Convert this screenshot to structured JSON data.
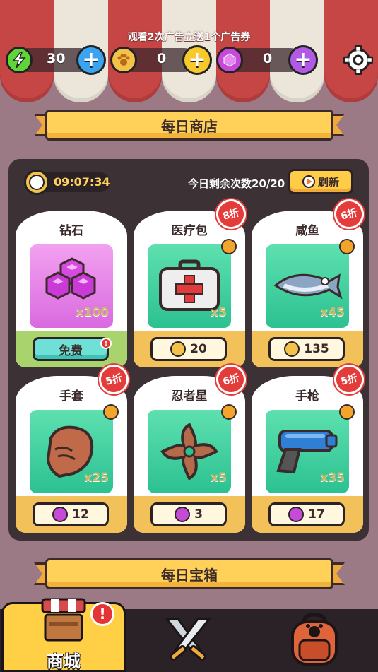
{
  "header": {
    "ad_text": "观看2次广告立送1个广告券",
    "resources": [
      {
        "icon": "energy-bolt-icon",
        "value": "30",
        "color": "#5ed63a"
      },
      {
        "icon": "paw-coin-icon",
        "value": "0",
        "color": "#f4c24a"
      },
      {
        "icon": "gem-icon",
        "value": "0",
        "color": "#c64ad8"
      }
    ]
  },
  "shop": {
    "title": "每日商店",
    "timer": "09:07:34",
    "remaining": "今日剩余次数20/20",
    "refresh_label": "刷新",
    "items": [
      {
        "name": "钻石",
        "qty": "x100",
        "price": "",
        "action": "免费",
        "discount": "",
        "currency": ""
      },
      {
        "name": "医疗包",
        "qty": "x5",
        "price": "20",
        "action": "",
        "discount": "8折",
        "currency": "coin"
      },
      {
        "name": "咸鱼",
        "qty": "x45",
        "price": "135",
        "action": "",
        "discount": "6折",
        "currency": "coin"
      },
      {
        "name": "手套",
        "qty": "x25",
        "price": "12",
        "action": "",
        "discount": "5折",
        "currency": "gem"
      },
      {
        "name": "忍者星",
        "qty": "x5",
        "price": "3",
        "action": "",
        "discount": "6折",
        "currency": "gem"
      },
      {
        "name": "手枪",
        "qty": "x35",
        "price": "17",
        "action": "",
        "discount": "5折",
        "currency": "gem"
      }
    ]
  },
  "chest": {
    "title": "每日宝箱"
  },
  "nav": {
    "tabs": [
      {
        "label": "商城",
        "icon": "shop-stall-icon",
        "active": true
      },
      {
        "label": "",
        "icon": "crossed-swords-icon",
        "active": false
      },
      {
        "label": "",
        "icon": "backpack-icon",
        "active": false
      }
    ]
  },
  "colors": {
    "accent": "#ffd158",
    "panel": "#3c3236",
    "background": "#9b7a86"
  }
}
